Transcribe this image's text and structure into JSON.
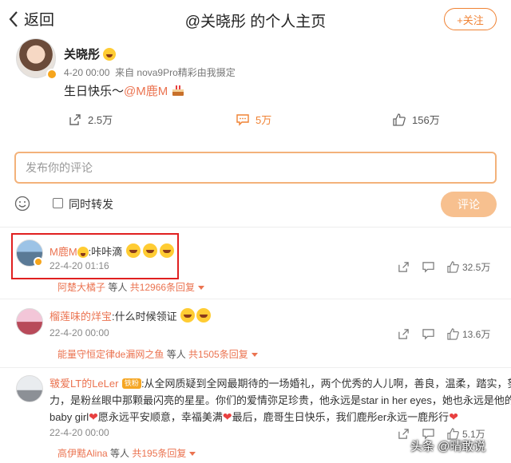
{
  "header": {
    "back_label": "返回",
    "title": "@关晓彤 的个人主页",
    "follow_label": "+关注"
  },
  "post": {
    "author": "关晓彤",
    "time": "4-20 00:00",
    "source": "来自 nova9Pro精彩由我摄定",
    "text": "生日快乐～",
    "mention": "@M鹿M",
    "reposts": "2.5万",
    "comments": "5万",
    "likes": "156万"
  },
  "compose": {
    "placeholder": "发布你的评论",
    "repost_label": "同时转发",
    "submit_label": "评论"
  },
  "comments": [
    {
      "name": "M鹿M",
      "text": ":咔咔滴",
      "time": "22-4-20 01:16",
      "likes": "32.5万",
      "reply_user": "阿楚大橘子",
      "reply_mid": " 等人 ",
      "reply_count": "共12966条回复"
    },
    {
      "name": "榴莲味的烊宝",
      "text": ":什么时候领证",
      "time": "22-4-20 00:00",
      "likes": "13.6万",
      "reply_user": "能量守恒定律de漏网之鱼",
      "reply_mid": " 等人 ",
      "reply_count": "共1505条回复"
    },
    {
      "name": "皲爱LT的LeLer",
      "tag": "铁粉",
      "line1": ":从全网质疑到全网最期待的一场婚礼，两个优秀的人儿啊，善良，温柔，踏实，努",
      "line2": "力，是粉丝眼中那颗最闪亮的星星。你们的爱情弥足珍贵，他永远是star in her eyes，她也永远是他的",
      "line3a": "baby girl",
      "line3b": "愿永远平安顺意，幸福美满",
      "line3c": "最后，鹿哥生日快乐，我们鹿彤er永远一鹿彤行",
      "time": "22-4-20 00:00",
      "likes": "5.1万",
      "reply_user": "高伊黠Alina",
      "reply_mid": " 等人 ",
      "reply_count": "共195条回复"
    }
  ],
  "watermark": "头条 @晴敢说",
  "colors": {
    "accent": "#eb7350",
    "follow": "#f08233",
    "highlight_box": "#e02020",
    "submit_disabled": "#f7c08f"
  }
}
